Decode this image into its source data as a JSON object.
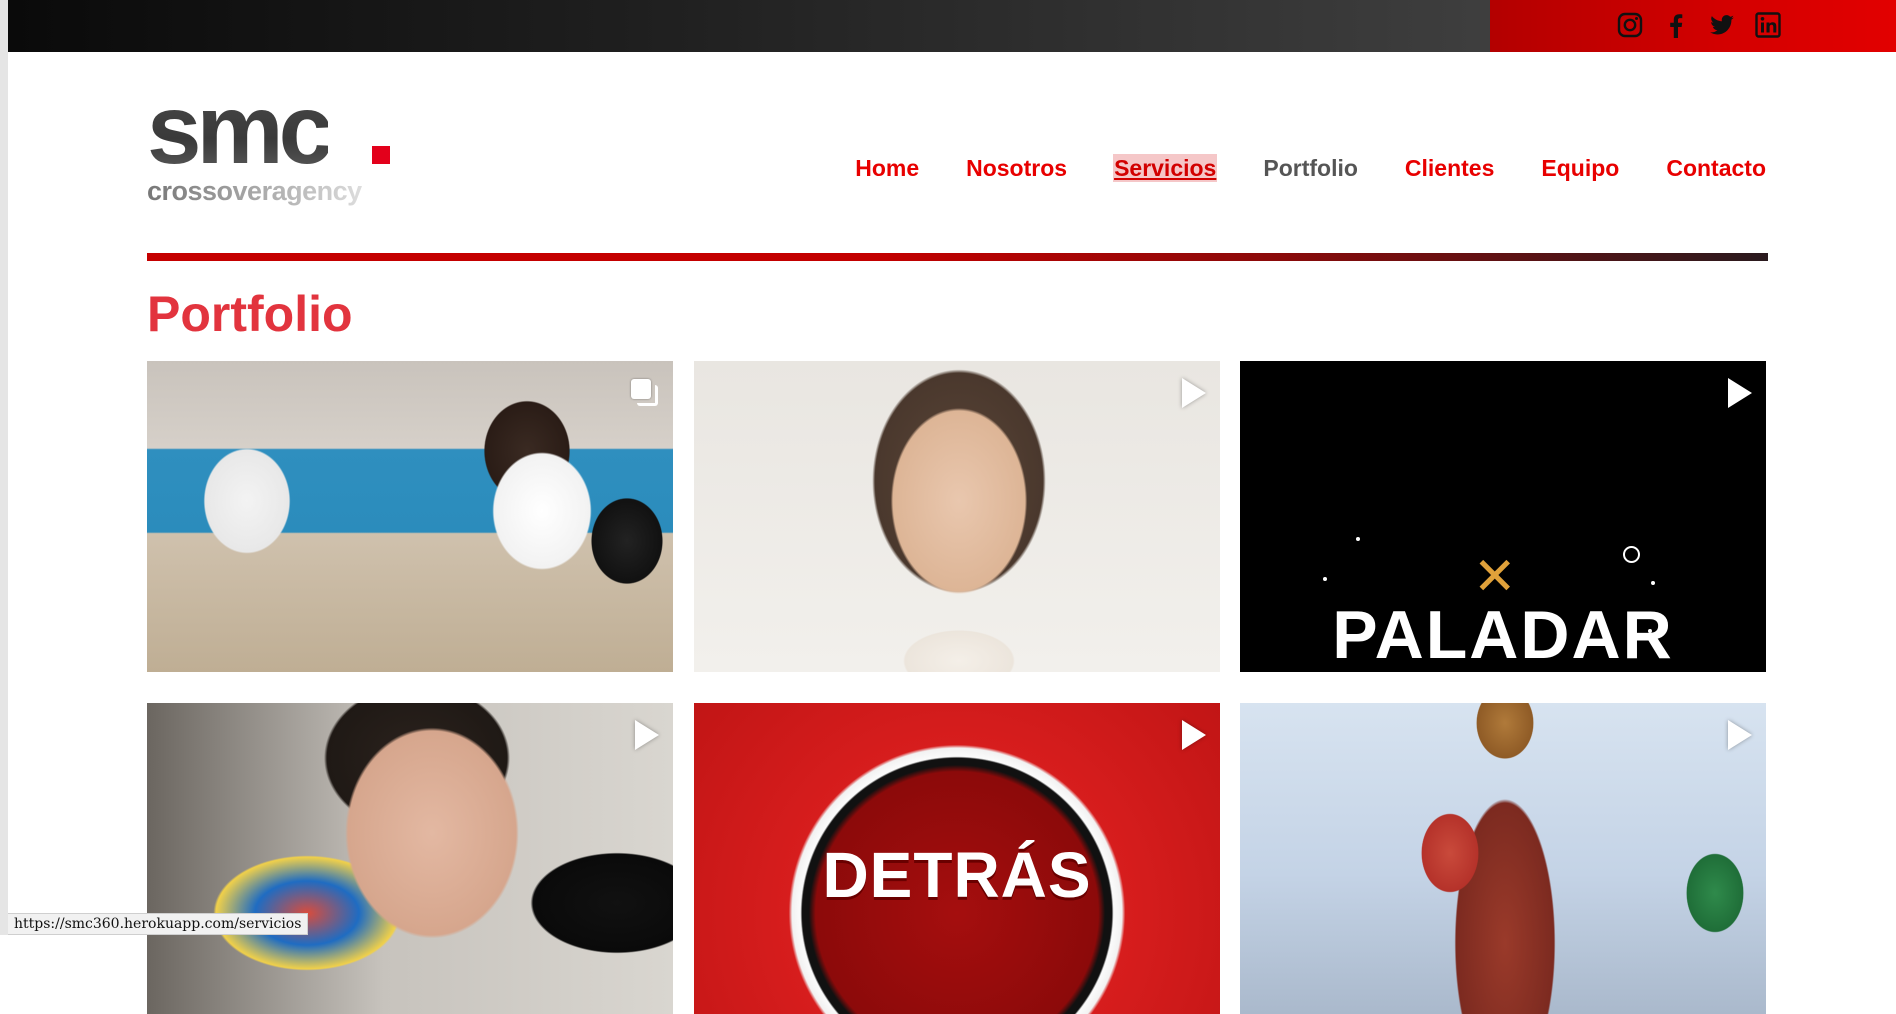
{
  "social": {
    "items": [
      {
        "name": "instagram-icon"
      },
      {
        "name": "facebook-icon"
      },
      {
        "name": "twitter-icon"
      },
      {
        "name": "linkedin-icon"
      }
    ]
  },
  "brand": {
    "logo_main": "smc",
    "logo_sub": "crossoveragency",
    "accent": "#e3001b"
  },
  "nav": {
    "items": [
      "Home",
      "Nosotros",
      "Servicios",
      "Portfolio",
      "Clientes",
      "Equipo",
      "Contacto"
    ],
    "active": "Portfolio",
    "hovered": "Servicios"
  },
  "page": {
    "title": "Portfolio"
  },
  "portfolio": {
    "tiles": [
      {
        "type": "gallery",
        "label": ""
      },
      {
        "type": "video",
        "label": ""
      },
      {
        "type": "video",
        "label": "PALADAR"
      },
      {
        "type": "video",
        "label": ""
      },
      {
        "type": "video",
        "label": "DETRÁS"
      },
      {
        "type": "video",
        "label": ""
      }
    ]
  },
  "status_bar": {
    "url": "https://smc360.herokuapp.com/servicios"
  },
  "colors": {
    "nav_red": "#e80000",
    "title_red": "#e2343e",
    "nav_current": "#555555"
  }
}
